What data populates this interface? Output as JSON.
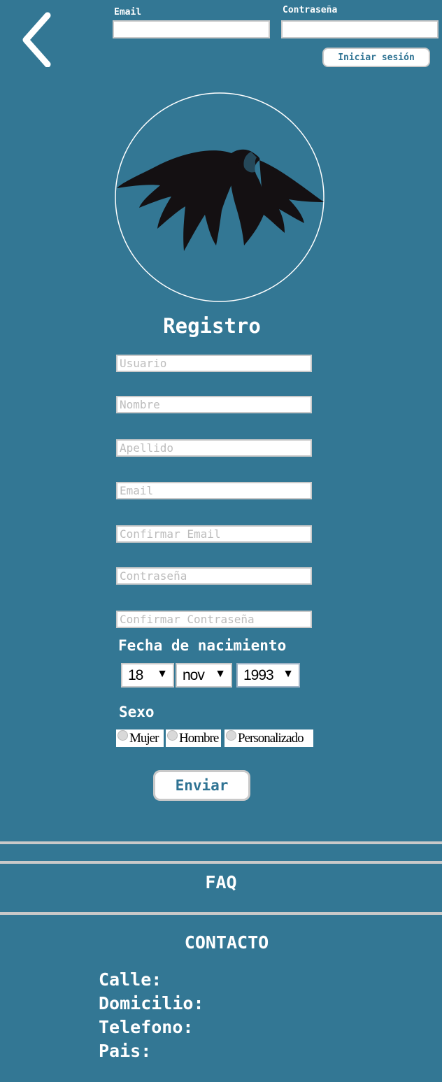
{
  "header": {
    "email_label": "Email",
    "password_label": "Contraseña",
    "login_button": "Iniciar sesión"
  },
  "register": {
    "title": "Registro",
    "placeholders": {
      "usuario": "Usuario",
      "nombre": "Nombre",
      "apellido": "Apellido",
      "email": "Email",
      "confirm_email": "Confirmar Email",
      "password": "Contraseña",
      "confirm_password": "Confirmar Contraseña"
    },
    "birth_label": "Fecha de nacimiento",
    "birth_day": "18",
    "birth_month": "nov",
    "birth_year": "1993",
    "sex_label": "Sexo",
    "sex_options": [
      "Mujer",
      "Hombre",
      "Personalizado"
    ],
    "submit": "Enviar"
  },
  "footer": {
    "faq": "FAQ",
    "contact_title": "CONTACTO",
    "contact_lines": [
      "Calle:",
      "Domicilio:",
      "Telefono:",
      "Pais:"
    ]
  },
  "icons": {
    "back": "chevron-left-icon",
    "logo": "eagle-logo-icon",
    "dropdown": "triangle-down-icon",
    "radio": "radio-circle-icon"
  }
}
